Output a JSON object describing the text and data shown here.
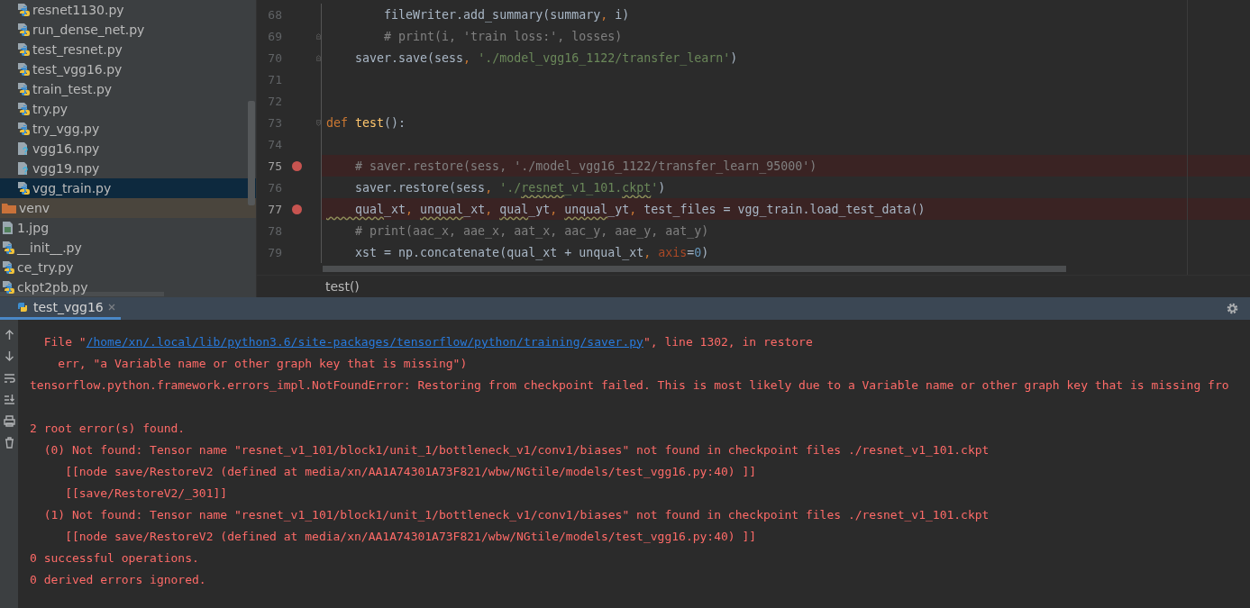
{
  "project_tree": {
    "items": [
      {
        "name": "resnet1130.py",
        "kind": "python",
        "nested": true,
        "selected": false,
        "excluded": false
      },
      {
        "name": "run_dense_net.py",
        "kind": "python",
        "nested": true,
        "selected": false,
        "excluded": false
      },
      {
        "name": "test_resnet.py",
        "kind": "python",
        "nested": true,
        "selected": false,
        "excluded": false
      },
      {
        "name": "test_vgg16.py",
        "kind": "python",
        "nested": true,
        "selected": false,
        "excluded": false
      },
      {
        "name": "train_test.py",
        "kind": "python",
        "nested": true,
        "selected": false,
        "excluded": false
      },
      {
        "name": "try.py",
        "kind": "python",
        "nested": true,
        "selected": false,
        "excluded": false
      },
      {
        "name": "try_vgg.py",
        "kind": "python",
        "nested": true,
        "selected": false,
        "excluded": false
      },
      {
        "name": "vgg16.npy",
        "kind": "unknown",
        "nested": true,
        "selected": false,
        "excluded": false
      },
      {
        "name": "vgg19.npy",
        "kind": "unknown",
        "nested": true,
        "selected": false,
        "excluded": false
      },
      {
        "name": "vgg_train.py",
        "kind": "python",
        "nested": true,
        "selected": true,
        "excluded": false
      },
      {
        "name": "venv",
        "kind": "folder",
        "nested": false,
        "selected": false,
        "excluded": true
      },
      {
        "name": "1.jpg",
        "kind": "image",
        "nested": false,
        "selected": false,
        "excluded": false
      },
      {
        "name": "__init__.py",
        "kind": "python",
        "nested": false,
        "selected": false,
        "excluded": false
      },
      {
        "name": "ce_try.py",
        "kind": "python",
        "nested": false,
        "selected": false,
        "excluded": false
      },
      {
        "name": "ckpt2pb.py",
        "kind": "python",
        "nested": false,
        "selected": false,
        "excluded": false
      }
    ]
  },
  "editor": {
    "lines": [
      {
        "number": "68",
        "breakpoint": false,
        "segments": [
          {
            "t": "        fileWriter.add_summary(summary",
            "kind": "plain"
          },
          {
            "t": ", ",
            "kind": "punct"
          },
          {
            "t": "i)",
            "kind": "plain"
          }
        ]
      },
      {
        "number": "69",
        "breakpoint": false,
        "fold": {
          "kind": "end"
        },
        "segments": [
          {
            "t": "        # print(i, 'train loss:', losses)",
            "kind": "comment"
          }
        ]
      },
      {
        "number": "70",
        "breakpoint": false,
        "fold": {
          "kind": "end"
        },
        "segments": [
          {
            "t": "    saver.save(sess",
            "kind": "plain"
          },
          {
            "t": ", ",
            "kind": "punct"
          },
          {
            "t": "'./model_vgg16_1122/transfer_learn'",
            "kind": "string"
          },
          {
            "t": ")",
            "kind": "plain"
          }
        ]
      },
      {
        "number": "71",
        "breakpoint": false
      },
      {
        "number": "72",
        "breakpoint": false
      },
      {
        "number": "73",
        "breakpoint": false,
        "fold": {
          "kind": "start"
        },
        "segments": [
          {
            "t": "def ",
            "kind": "keyword"
          },
          {
            "t": "test",
            "kind": "function"
          },
          {
            "t": "():",
            "kind": "plain"
          }
        ]
      },
      {
        "number": "74",
        "breakpoint": false
      },
      {
        "number": "75",
        "breakpoint": true,
        "segments": [
          {
            "t": "    # saver.restore(sess, './model_vgg16_1122/transfer_learn_95000')",
            "kind": "comment"
          }
        ]
      },
      {
        "number": "76",
        "breakpoint": false,
        "segments": [
          {
            "t": "    saver.restore(sess",
            "kind": "plain"
          },
          {
            "t": ", ",
            "kind": "punct"
          },
          {
            "t": "'./",
            "kind": "string"
          },
          {
            "t": "resnet",
            "kind": "string_warn"
          },
          {
            "t": "_v1_101.",
            "kind": "string"
          },
          {
            "t": "ckpt",
            "kind": "string_warn"
          },
          {
            "t": "'",
            "kind": "string"
          },
          {
            "t": ")",
            "kind": "plain"
          }
        ]
      },
      {
        "number": "77",
        "breakpoint": true,
        "segments": [
          {
            "t": "    qual",
            "kind": "warn"
          },
          {
            "t": "_xt",
            "kind": "plain"
          },
          {
            "t": ", ",
            "kind": "punct"
          },
          {
            "t": "unqual",
            "kind": "warn"
          },
          {
            "t": "_xt",
            "kind": "plain"
          },
          {
            "t": ", ",
            "kind": "punct"
          },
          {
            "t": "qual",
            "kind": "warn"
          },
          {
            "t": "_yt",
            "kind": "plain"
          },
          {
            "t": ", ",
            "kind": "punct"
          },
          {
            "t": "unqual",
            "kind": "warn"
          },
          {
            "t": "_yt",
            "kind": "plain"
          },
          {
            "t": ", ",
            "kind": "punct"
          },
          {
            "t": "test_files = vgg_train.load_test_data()",
            "kind": "plain"
          }
        ]
      },
      {
        "number": "78",
        "breakpoint": false,
        "segments": [
          {
            "t": "    # print(aac_x, aae_x, aat_x, aac_y, aae_y, aat_y)",
            "kind": "comment"
          }
        ]
      },
      {
        "number": "79",
        "breakpoint": false,
        "segments": [
          {
            "t": "    xst = np.concatenate(qual_xt + unqual_xt",
            "kind": "plain"
          },
          {
            "t": ", ",
            "kind": "punct"
          },
          {
            "t": "axis",
            "kind": "param"
          },
          {
            "t": "=",
            "kind": "plain"
          },
          {
            "t": "0",
            "kind": "number"
          },
          {
            "t": ")",
            "kind": "plain"
          }
        ]
      }
    ],
    "breadcrumb": "test()"
  },
  "run_panel": {
    "tabs": [
      {
        "label": "test_vgg16",
        "selected": true
      }
    ],
    "console_lines": [
      {
        "kind": "error",
        "segments": [
          {
            "t": "  File \"",
            "kind": "text"
          },
          {
            "t": "/home/xn/.local/lib/python3.6/site-packages/tensorflow/python/training/saver.py",
            "kind": "link"
          },
          {
            "t": "\", line 1302, in restore",
            "kind": "text"
          }
        ]
      },
      {
        "kind": "error",
        "segments": [
          {
            "t": "    err, \"a Variable name or other graph key that is missing\")",
            "kind": "text"
          }
        ]
      },
      {
        "kind": "error",
        "segments": [
          {
            "t": "tensorflow.python.framework.errors_impl.NotFoundError: Restoring from checkpoint failed. This is most likely due to a Variable name or other graph key that is missing fro",
            "kind": "text"
          }
        ]
      },
      {
        "kind": "blank"
      },
      {
        "kind": "error",
        "segments": [
          {
            "t": "2 root error(s) found.",
            "kind": "text"
          }
        ]
      },
      {
        "kind": "error",
        "segments": [
          {
            "t": "  (0) Not found: Tensor name \"resnet_v1_101/block1/unit_1/bottleneck_v1/conv1/biases\" not found in checkpoint files ./resnet_v1_101.ckpt",
            "kind": "text"
          }
        ]
      },
      {
        "kind": "error",
        "segments": [
          {
            "t": "     [[node save/RestoreV2 (defined at media/xn/AA1A74301A73F821/wbw/NGtile/models/test_vgg16.py:40) ]]",
            "kind": "text"
          }
        ]
      },
      {
        "kind": "error",
        "segments": [
          {
            "t": "     [[save/RestoreV2/_301]]",
            "kind": "text"
          }
        ]
      },
      {
        "kind": "error",
        "segments": [
          {
            "t": "  (1) Not found: Tensor name \"resnet_v1_101/block1/unit_1/bottleneck_v1/conv1/biases\" not found in checkpoint files ./resnet_v1_101.ckpt",
            "kind": "text"
          }
        ]
      },
      {
        "kind": "error",
        "segments": [
          {
            "t": "     [[node save/RestoreV2 (defined at media/xn/AA1A74301A73F821/wbw/NGtile/models/test_vgg16.py:40) ]]",
            "kind": "text"
          }
        ]
      },
      {
        "kind": "error",
        "segments": [
          {
            "t": "0 successful operations.",
            "kind": "text"
          }
        ]
      },
      {
        "kind": "error",
        "segments": [
          {
            "t": "0 derived errors ignored.",
            "kind": "text"
          }
        ]
      }
    ]
  }
}
